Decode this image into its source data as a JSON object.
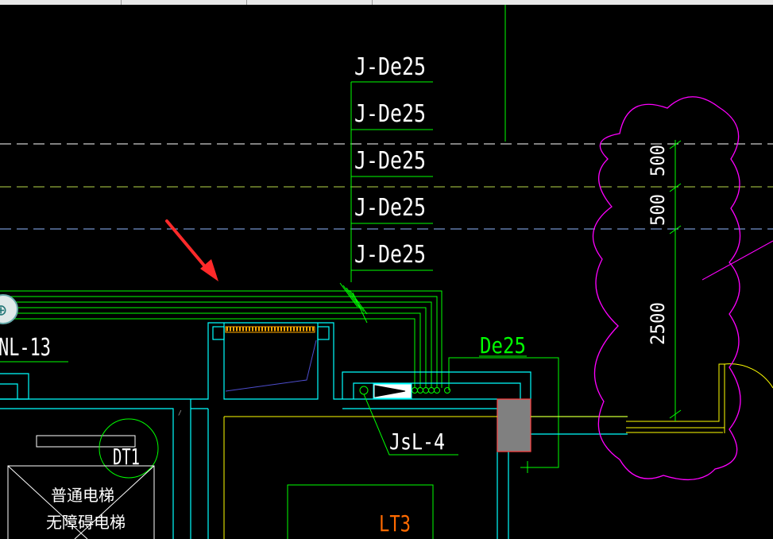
{
  "drawing": {
    "pipe_labels": [
      "J-De25",
      "J-De25",
      "J-De25",
      "J-De25",
      "J-De25"
    ],
    "riser_label": "De25",
    "pipe_id": "NL-13",
    "fixture_label": "JsL-4",
    "stair_label": "LT3",
    "elevator_id": "DT1",
    "elevator_note_1": "普通电梯",
    "elevator_note_2": "无障碍电梯",
    "dim_1": "500",
    "dim_2": "500",
    "dim_3": "2500"
  },
  "colors": {
    "background": "#000000",
    "pipe": "#00ff00",
    "wall": "#00ffff",
    "slab": "#ffff00",
    "revision_cloud": "#ff00ff",
    "annotation_arrow": "#ff2a2a",
    "text": "#ffffff",
    "stair_text": "#ff6a00",
    "column_fill": "#808080"
  }
}
